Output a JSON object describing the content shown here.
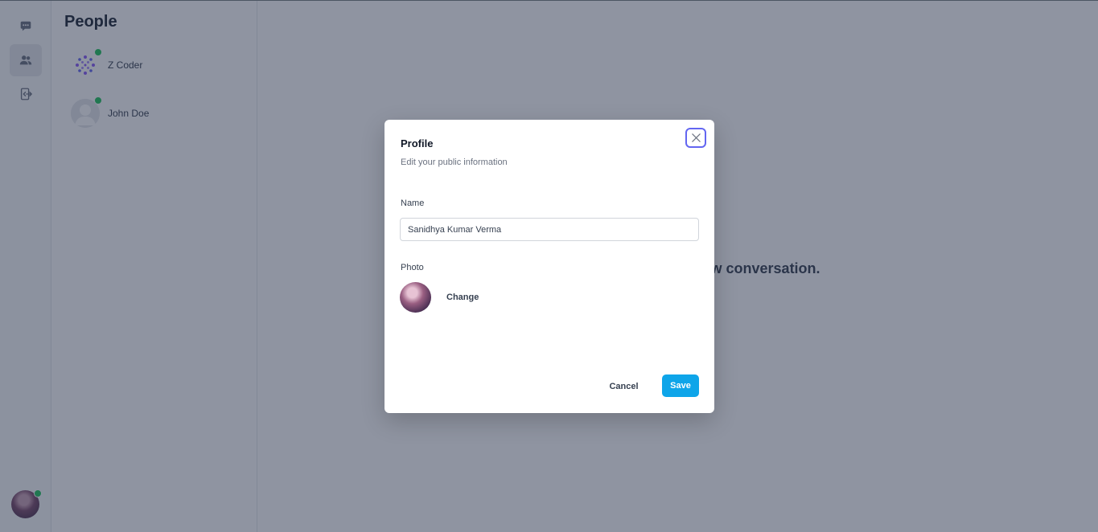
{
  "sidebar": {
    "nav": [
      {
        "icon": "chat-bubble-icon",
        "active": false
      },
      {
        "icon": "users-icon",
        "active": true
      },
      {
        "icon": "logout-icon",
        "active": false
      }
    ],
    "user_online": true
  },
  "people": {
    "title": "People",
    "list": [
      {
        "name": "Z Coder",
        "online": true,
        "avatar": "dot-pattern-avatar"
      },
      {
        "name": "John Doe",
        "online": true,
        "avatar": "default-user-avatar"
      }
    ]
  },
  "main": {
    "empty_message": "Select a chat or start a new conversation."
  },
  "modal": {
    "title": "Profile",
    "subtitle": "Edit your public information",
    "name_label": "Name",
    "name_value": "Sanidhya Kumar Verma",
    "photo_label": "Photo",
    "change_label": "Change",
    "cancel_label": "Cancel",
    "save_label": "Save"
  },
  "colors": {
    "accent": "#0ea5e9",
    "focus_ring": "#6366f1",
    "online": "#22c55e"
  }
}
